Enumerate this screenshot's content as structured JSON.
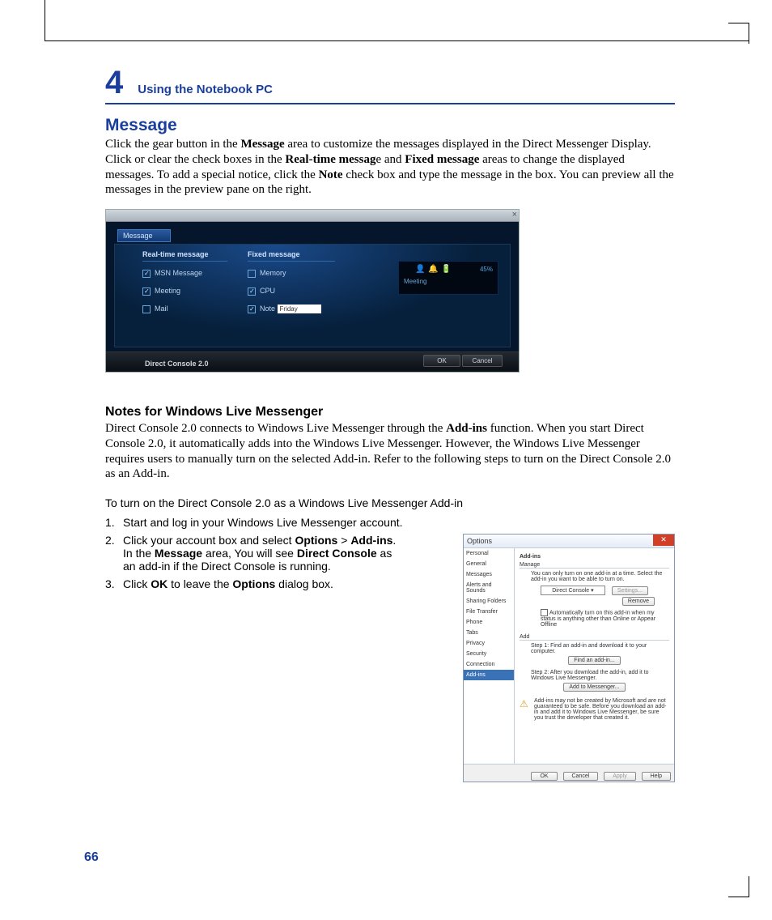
{
  "chapter": {
    "number": "4",
    "title": "Using the Notebook PC"
  },
  "h1": "Message",
  "p1_a": "Click the gear button in the ",
  "p1_b": "Message",
  "p1_c": " area to customize the messages displayed in the Direct Messenger Display. Click or clear the check boxes in the ",
  "p1_d": "Real-time messag",
  "p1_e": "e and ",
  "p1_f": "Fixed message",
  "p1_g": " areas to change the displayed messages. To add a special notice, click the ",
  "p1_h": "Note",
  "p1_i": " check box and type the message in the box. You can preview all the messages in the preview pane on the right.",
  "dc": {
    "tab": "Message",
    "col1": "Real-time message",
    "col2": "Fixed message",
    "rt": [
      {
        "l": "MSN Message",
        "c": true
      },
      {
        "l": "Meeting",
        "c": true
      },
      {
        "l": "Mail",
        "c": false
      }
    ],
    "fx": [
      {
        "l": "Memory",
        "c": false
      },
      {
        "l": "CPU",
        "c": true
      },
      {
        "l": "Note",
        "c": true
      }
    ],
    "note": "Friday",
    "preview_text": "Meeting",
    "preview_pct": "45%",
    "logo": "Direct Console 2.0",
    "ok": "OK",
    "cancel": "Cancel"
  },
  "h2": "Notes for Windows Live Messenger",
  "p2_a": "Direct Console 2.0 connects to Windows Live Messenger through the ",
  "p2_b": "Add-ins",
  "p2_c": " function. When you start Direct Console 2.0, it automatically adds into the Windows Live Messenger. However, the Windows Live Messenger requires users to manually turn on the selected Add-in. Refer to the following steps to turn on the Direct Console 2.0 as an Add-in.",
  "lead": "To turn on the Direct Console 2.0 as a Windows Live Messenger Add-in",
  "steps": {
    "s1": {
      "n": "1.",
      "t": "Start and log in your Windows Live Messenger account."
    },
    "s2": {
      "n": "2.",
      "a": "Click your account box and select ",
      "b": "Options",
      "c": " > ",
      "d": "Add-ins",
      "e": ". In the ",
      "f": "Message",
      "g": " area, You will see ",
      "h": "Direct Console",
      "i": " as an add-in if the Direct Console is running."
    },
    "s3": {
      "n": "3.",
      "a": "Click ",
      "b": "OK",
      "c": " to leave the ",
      "d": "Options",
      "e": " dialog box."
    }
  },
  "opt": {
    "title": "Options",
    "side": [
      "Personal",
      "General",
      "Messages",
      "Alerts and Sounds",
      "Sharing Folders",
      "File Transfer",
      "Phone",
      "Tabs",
      "Privacy",
      "Security",
      "Connection",
      "Add-ins"
    ],
    "sec1": "Add-ins",
    "sec1b": "Manage",
    "p1": "You can only turn on one add-in at a time. Select the add-in you want to be able to turn on.",
    "sel": "Direct Console",
    "settings": "Settings...",
    "remove": "Remove",
    "auto": "Automatically turn on this add-in when my status is anything other than Online or Appear Offline",
    "sec2": "Add",
    "step1": "Step 1: Find an add-in and download it to your computer.",
    "find": "Find an add-in...",
    "step2": "Step 2: After you download the add-in, add it to Windows Live Messenger.",
    "add": "Add to Messenger...",
    "warn": "Add-ins may not be created by Microsoft and are not guaranteed to be safe. Before you download an add-in and add it to Windows Live Messenger, be sure you trust the developer that created it.",
    "ok": "OK",
    "cancel": "Cancel",
    "apply": "Apply",
    "help": "Help"
  },
  "page": "66"
}
